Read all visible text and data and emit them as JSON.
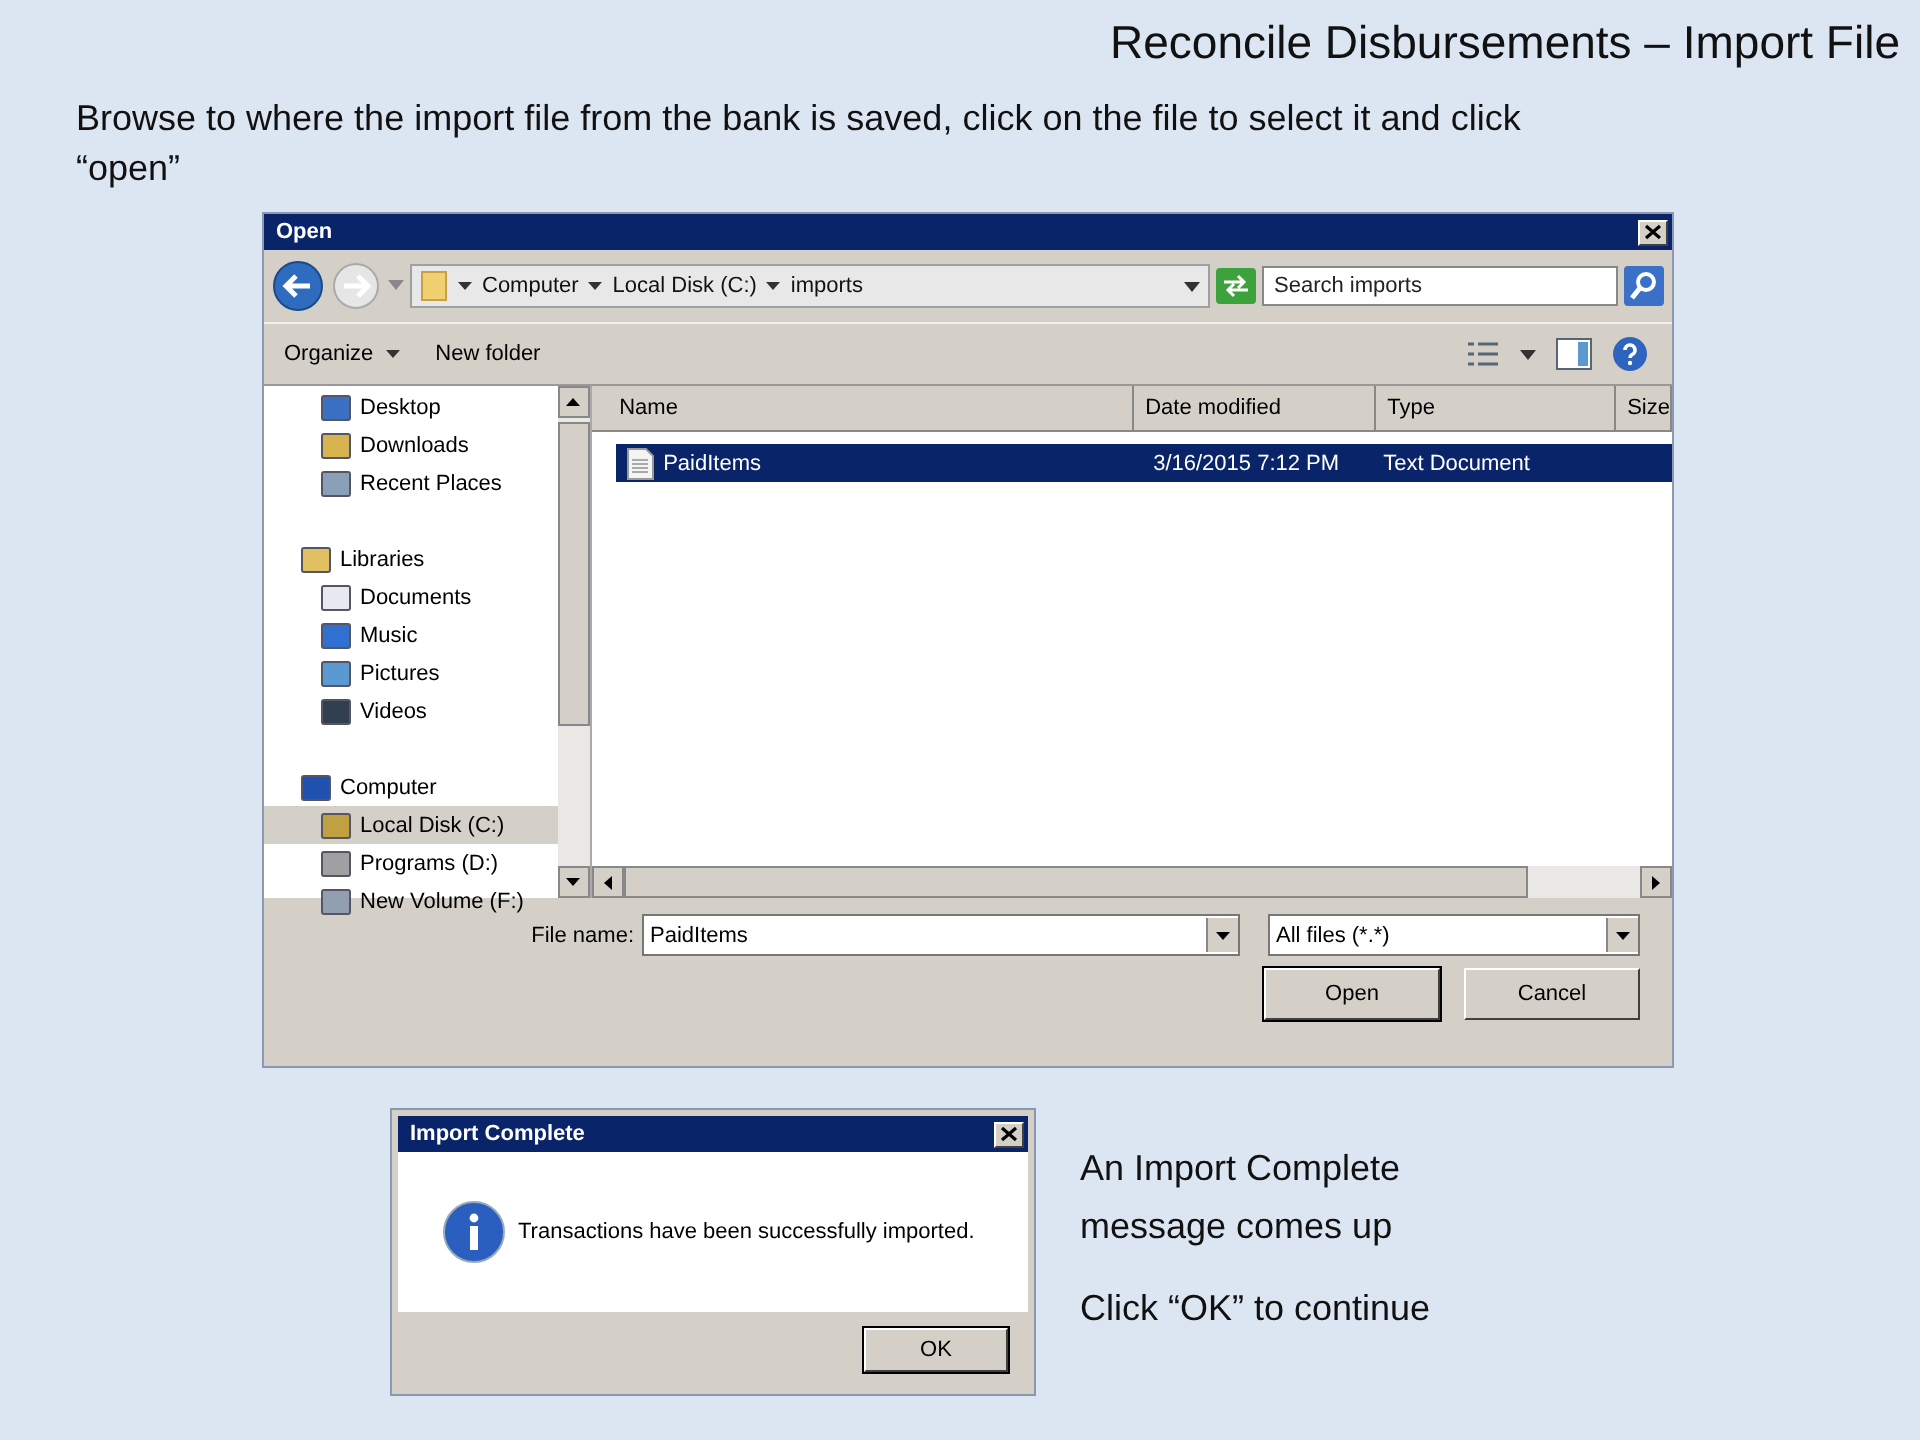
{
  "slide": {
    "title": "Reconcile Disbursements – Import File",
    "instruction": "Browse to where the import file from the bank is saved, click on the file to select it and click “open”"
  },
  "open_dialog": {
    "title": "Open",
    "breadcrumb": [
      "Computer",
      "Local Disk (C:)",
      "imports"
    ],
    "search": {
      "placeholder": "Search imports"
    },
    "toolbar": [
      {
        "label": "Organize",
        "dropdown": true
      },
      {
        "label": "New folder",
        "dropdown": false
      }
    ],
    "nav_items": [
      {
        "kind": "item",
        "label": "Desktop",
        "selected": false
      },
      {
        "kind": "item",
        "label": "Downloads",
        "selected": false
      },
      {
        "kind": "item",
        "label": "Recent Places",
        "selected": false
      },
      {
        "kind": "header",
        "label": "Libraries",
        "selected": false
      },
      {
        "kind": "item",
        "label": "Documents",
        "selected": false
      },
      {
        "kind": "item",
        "label": "Music",
        "selected": false
      },
      {
        "kind": "item",
        "label": "Pictures",
        "selected": false
      },
      {
        "kind": "item",
        "label": "Videos",
        "selected": false
      },
      {
        "kind": "header",
        "label": "Computer",
        "selected": false
      },
      {
        "kind": "item",
        "label": "Local Disk (C:)",
        "selected": true
      },
      {
        "kind": "item",
        "label": "Programs (D:)",
        "selected": false
      },
      {
        "kind": "item",
        "label": "New Volume (F:)",
        "selected": false
      }
    ],
    "columns": [
      "Name",
      "Date modified",
      "Type",
      "Size"
    ],
    "rows": [
      {
        "name": "PaidItems",
        "date_modified": "3/16/2015 7:12 PM",
        "type": "Text Document",
        "selected": true
      }
    ],
    "file_name_label": "File name:",
    "file_name": "PaidItems",
    "file_type": "All files (*.*)",
    "buttons": [
      "Open",
      "Cancel"
    ]
  },
  "message_dialog": {
    "title": "Import Complete",
    "message": "Transactions have been successfully imported.",
    "button": "OK"
  },
  "notes": [
    "An Import Complete message comes up",
    "Click “OK” to continue"
  ]
}
